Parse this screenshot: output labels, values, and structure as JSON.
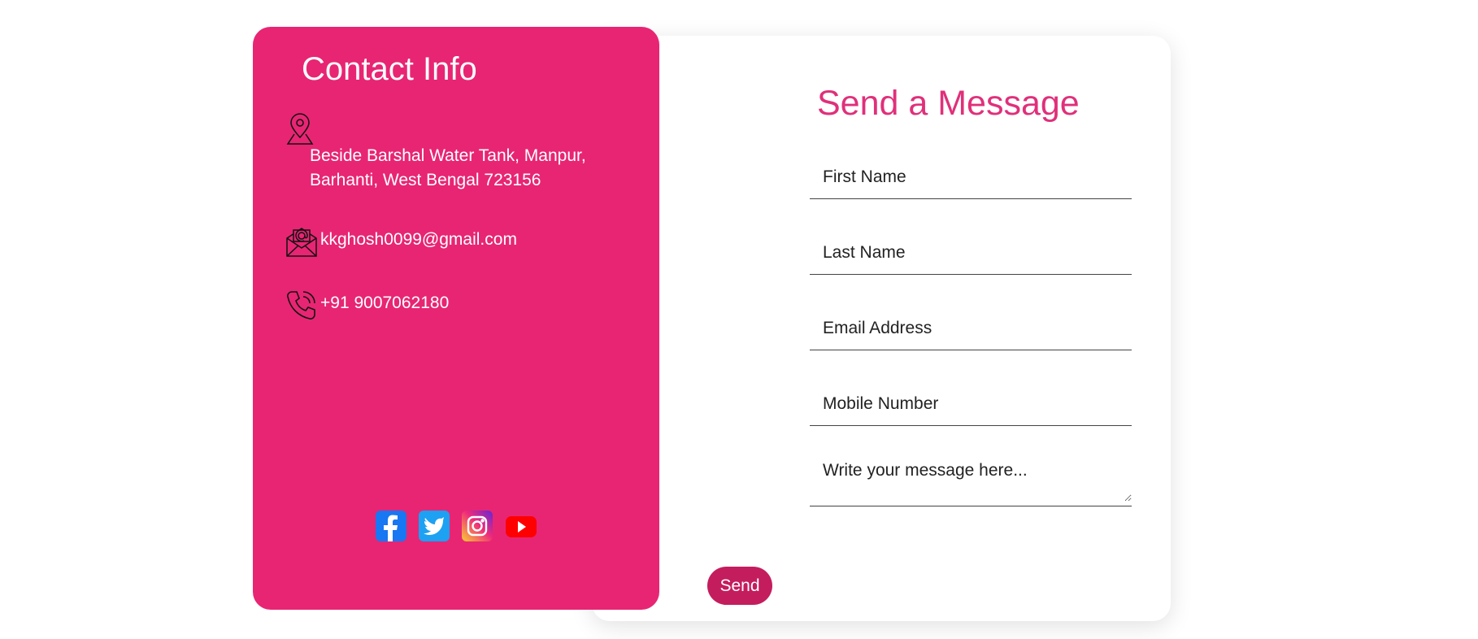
{
  "contact": {
    "title": "Contact Info",
    "address": "Beside Barshal Water Tank, Manpur, Barhanti, West Bengal 723156",
    "email": "kkghosh0099@gmail.com",
    "phone": "+91 9007062180",
    "icons": [
      "location-pin-icon",
      "envelope-icon",
      "phone-icon"
    ],
    "social": [
      "facebook-icon",
      "twitter-icon",
      "instagram-icon",
      "youtube-icon"
    ],
    "accent": "#e82573"
  },
  "form": {
    "title": "Send a Message",
    "first_name_placeholder": "First Name",
    "last_name_placeholder": "Last Name",
    "email_placeholder": "Email Address",
    "mobile_placeholder": "Mobile Number",
    "message_placeholder": "Write your message here...",
    "send_label": "Send",
    "accent": "#e0307a",
    "button_color": "#c41d5e"
  }
}
